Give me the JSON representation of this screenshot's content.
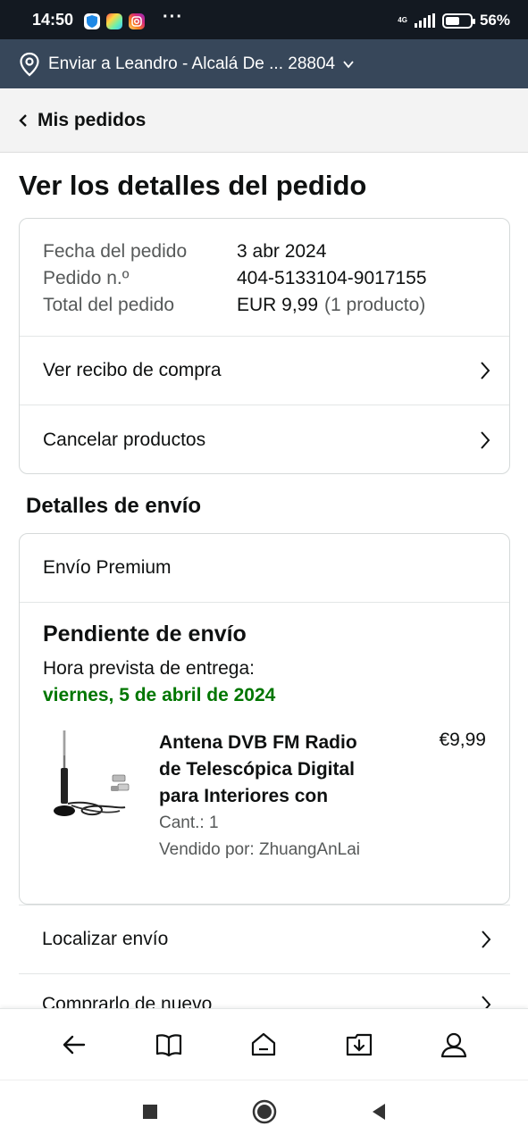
{
  "status_bar": {
    "time": "14:50",
    "battery_percent": "56%",
    "battery_level": 0.56,
    "network": "4G",
    "icons": [
      "shield-app-icon",
      "colorful-app-icon",
      "instagram-icon",
      "more-dots-icon",
      "signal-icon",
      "battery-icon"
    ]
  },
  "address_bar": {
    "text": "Enviar a Leandro - Alcalá De ... 28804",
    "icon": "location-pin-icon"
  },
  "back_nav": {
    "label": "Mis pedidos"
  },
  "page": {
    "title": "Ver los detalles del pedido"
  },
  "order_summary": {
    "rows": [
      {
        "label": "Fecha del pedido",
        "value": "3 abr 2024",
        "extra": ""
      },
      {
        "label": "Pedido n.º",
        "value": "404-5133104-9017155",
        "extra": ""
      },
      {
        "label": "Total del pedido",
        "value": "EUR 9,99",
        "extra": "(1 producto)"
      }
    ],
    "receipt_link": "Ver recibo de compra",
    "cancel_link": "Cancelar productos"
  },
  "shipping": {
    "heading": "Detalles de envío",
    "method": "Envío Premium",
    "status": "Pendiente de envío",
    "eta_label": "Hora prevista de entrega:",
    "eta_date": "viernes, 5 de abril de 2024",
    "product": {
      "title": "Antena DVB FM Radio de Telescópica Digital para Interiores con",
      "price": "€9,99",
      "quantity": "Cant.: 1",
      "seller": "Vendido por: ZhuangAnLai"
    }
  },
  "actions": {
    "track": "Localizar envío",
    "buy_again": "Comprarlo de nuevo"
  },
  "colors": {
    "header_dark": "#131921",
    "address_bar": "#37475a",
    "delivery_green": "#007600",
    "muted_text": "#565959"
  },
  "bottom_nav": [
    "back-arrow-icon",
    "book-icon",
    "home-icon",
    "download-icon",
    "profile-icon"
  ],
  "system_nav": [
    "recents-square-icon",
    "home-circle-icon",
    "back-triangle-icon"
  ]
}
